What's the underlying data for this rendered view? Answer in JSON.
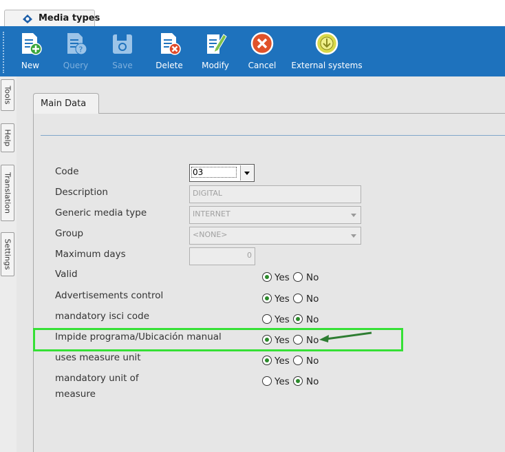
{
  "window": {
    "tab_title": "Media types"
  },
  "toolbar": {
    "buttons": [
      {
        "label": "New",
        "enabled": true
      },
      {
        "label": "Query",
        "enabled": false
      },
      {
        "label": "Save",
        "enabled": false
      },
      {
        "label": "Delete",
        "enabled": true
      },
      {
        "label": "Modify",
        "enabled": true
      },
      {
        "label": "Cancel",
        "enabled": true
      },
      {
        "label": "External systems",
        "enabled": true
      }
    ]
  },
  "sidebar": {
    "tabs": [
      "Tools",
      "Help",
      "Translation",
      "Settings"
    ]
  },
  "main": {
    "tab": "Main Data",
    "radio_labels": {
      "yes": "Yes",
      "no": "No"
    },
    "fields": {
      "code": {
        "label": "Code",
        "value": "03"
      },
      "description": {
        "label": "Description",
        "value": "DIGITAL"
      },
      "generic_media_type": {
        "label": "Generic media type",
        "value": "INTERNET"
      },
      "group": {
        "label": "Group",
        "value": "<NONE>"
      },
      "maximum_days": {
        "label": "Maximum days",
        "value": "0"
      },
      "valid": {
        "label": "Valid",
        "selected": "Yes"
      },
      "advertisements_control": {
        "label": "Advertisements control",
        "selected": "Yes"
      },
      "mandatory_isci_code": {
        "label": "mandatory isci code",
        "selected": "No"
      },
      "impide_programa": {
        "label": "Impide programa/Ubicación manual",
        "selected": "Yes"
      },
      "uses_measure_unit": {
        "label": "uses measure unit",
        "selected": "Yes"
      },
      "mandatory_unit_of_measure": {
        "label_line1": "mandatory unit of",
        "label_line2": "measure",
        "selected": "No"
      }
    }
  },
  "colors": {
    "toolbar": "#1e72bd",
    "highlight": "#35e035",
    "arrow": "#2e7d32"
  }
}
